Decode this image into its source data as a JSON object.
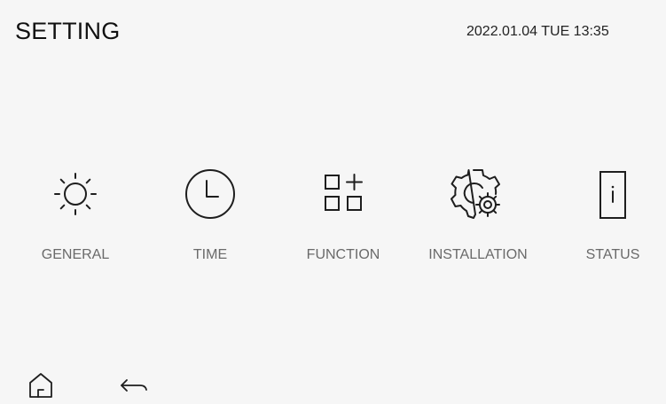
{
  "header": {
    "title": "SETTING",
    "datetime": "2022.01.04 TUE 13:35"
  },
  "menu": [
    {
      "id": "general",
      "label": "GENERAL",
      "icon": "sun-icon"
    },
    {
      "id": "time",
      "label": "TIME",
      "icon": "clock-icon"
    },
    {
      "id": "function",
      "label": "FUNCTION",
      "icon": "apps-grid-plus-icon"
    },
    {
      "id": "installation",
      "label": "INSTALLATION",
      "icon": "gear-icon"
    },
    {
      "id": "status",
      "label": "STATUS",
      "icon": "info-icon"
    }
  ],
  "footer": {
    "home_icon": "home-icon",
    "back_icon": "back-arrow-icon"
  },
  "colors": {
    "background": "#f6f6f6",
    "text_primary": "#111111",
    "text_label": "#6a6a6a",
    "icon_stroke": "#1e1e1e"
  }
}
